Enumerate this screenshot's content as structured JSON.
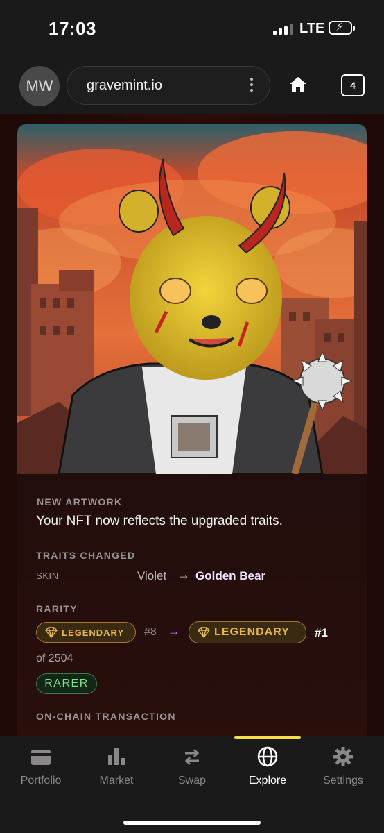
{
  "status_bar": {
    "time": "17:03",
    "network": "LTE"
  },
  "browser": {
    "avatar_initials": "MW",
    "url": "gravemint.io",
    "tab_count": "4"
  },
  "nft_card": {
    "artwork_section_label": "NEW ARTWORK",
    "artwork_message": "Your NFT now reflects the upgraded traits.",
    "traits_section_label": "TRAITS CHANGED",
    "trait": {
      "name": "SKIN",
      "from": "Violet",
      "arrow": "→",
      "to": "Golden Bear"
    },
    "rarity_section_label": "RARITY",
    "rarity_old": {
      "tier": "LEGENDARY",
      "rank": "#8"
    },
    "rarity_arrow": "→",
    "rarity_new": {
      "tier": "LEGENDARY",
      "rank": "#1"
    },
    "rarity_total": "of 2504",
    "rarity_change_badge": "RARER",
    "transaction_section_label": "ON-CHAIN TRANSACTION"
  },
  "nav": {
    "items": [
      {
        "label": "Portfolio",
        "icon": "wallet-icon"
      },
      {
        "label": "Market",
        "icon": "bar-chart-icon"
      },
      {
        "label": "Swap",
        "icon": "swap-arrows-icon"
      },
      {
        "label": "Explore",
        "icon": "globe-icon"
      },
      {
        "label": "Settings",
        "icon": "gear-icon"
      }
    ],
    "active": "Explore"
  },
  "colors": {
    "accent_active": "#f5dd4b",
    "legendary_gold": "#e8b94a",
    "rarer_green": "#7fe08f",
    "trait_arrow_purple": "#b07cf0"
  }
}
